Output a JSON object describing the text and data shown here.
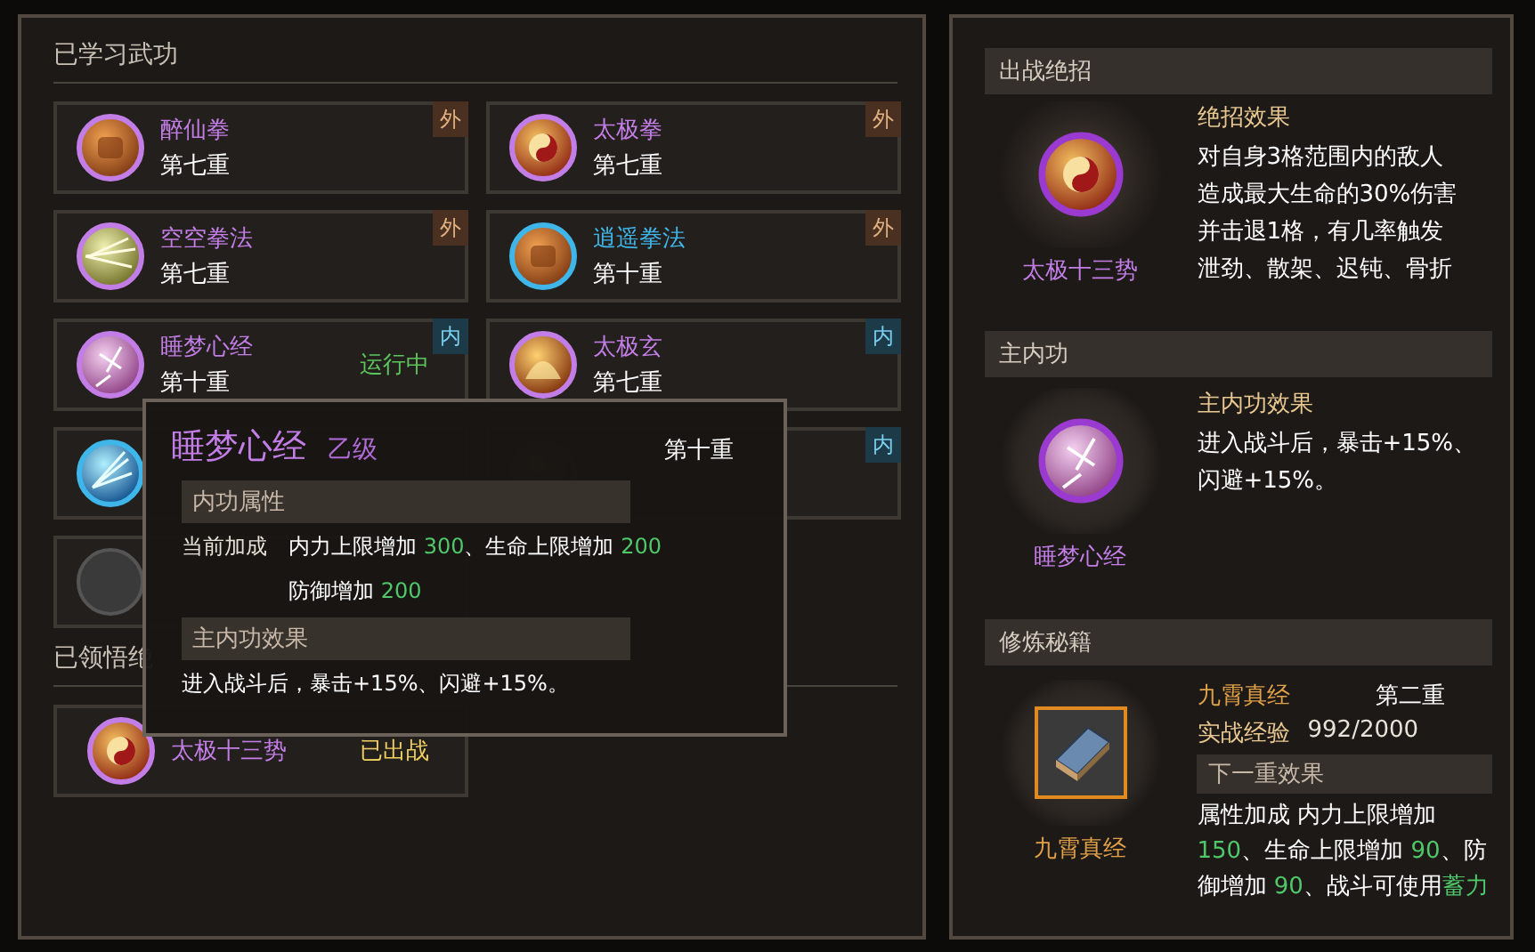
{
  "learned": {
    "title": "已学习武功",
    "skills": [
      {
        "kind": "skill",
        "name": "醉仙拳",
        "rank": "第七重",
        "color": "#c27ee6",
        "badge": {
          "text": "外",
          "kind": "outer"
        }
      },
      {
        "kind": "skill",
        "name": "太极拳",
        "rank": "第七重",
        "color": "#c27ee6",
        "badge": {
          "text": "外",
          "kind": "outer"
        }
      },
      {
        "kind": "skill",
        "name": "空空拳法",
        "rank": "第七重",
        "color": "#c27ee6",
        "badge": {
          "text": "外",
          "kind": "outer"
        }
      },
      {
        "kind": "skill",
        "name": "逍遥拳法",
        "rank": "第十重",
        "color": "#3fb6ea",
        "badge": {
          "text": "外",
          "kind": "outer"
        }
      },
      {
        "kind": "skill",
        "name": "睡梦心经",
        "rank": "第十重",
        "color": "#c27ee6",
        "badge": {
          "text": "内",
          "kind": "inner"
        },
        "status": {
          "text": "运行中",
          "kind": "running"
        }
      },
      {
        "kind": "skill",
        "name": "太极玄",
        "rank": "第七重",
        "color": "#c27ee6",
        "badge": {
          "text": "内",
          "kind": "inner"
        }
      },
      {
        "kind": "covered",
        "color": "#3fb6ea"
      },
      {
        "kind": "covered",
        "badge": {
          "text": "内",
          "kind": "inner"
        }
      },
      {
        "kind": "empty"
      }
    ]
  },
  "ultimates": {
    "title": "已领悟绝",
    "skills": [
      {
        "kind": "skill",
        "name": "太极十三势",
        "color": "#c27ee6",
        "status": {
          "text": "已出战",
          "kind": "deployed"
        }
      }
    ]
  },
  "tooltip": {
    "name": "睡梦心经",
    "grade": "乙级",
    "rank": "第十重",
    "attr_header": "内功属性",
    "bonus_label": "当前加成",
    "bonus_lines": [
      [
        {
          "text": "内力上限增加 ",
          "hl": false
        },
        {
          "text": "300",
          "hl": true
        },
        {
          "text": "、生命上限增加 ",
          "hl": false
        },
        {
          "text": "200",
          "hl": true
        }
      ],
      [
        {
          "text": "防御增加 ",
          "hl": false
        },
        {
          "text": "200",
          "hl": true
        }
      ]
    ],
    "effect_header": "主内功效果",
    "effect": "进入战斗后，暴击+15%、闪避+15%。"
  },
  "right": {
    "combat": {
      "header": "出战绝招",
      "name": "太极十三势",
      "effect_title": "绝招效果",
      "effect": "对自身3格范围内的敌人造成最大生命的30%伤害并击退1格，有几率触发泄劲、散架、迟钝、骨折"
    },
    "main_inner": {
      "header": "主内功",
      "name": "睡梦心经",
      "effect_title": "主内功效果",
      "effect": "进入战斗后，暴击+15%、闪避+15%。"
    },
    "manual": {
      "header": "修炼秘籍",
      "name": "九霄真经",
      "book_name": "九霄真经",
      "rank": "第二重",
      "exp_label": "实战经验",
      "exp": "992/2000",
      "next_header": "下一重效果",
      "bonus": [
        {
          "text": "属性加成  内力上限增加 ",
          "hl": false
        },
        {
          "text": "150",
          "hl": true
        },
        {
          "text": "、生命上限增加 ",
          "hl": false
        },
        {
          "text": "90",
          "hl": true
        },
        {
          "text": "、防御增加 ",
          "hl": false
        },
        {
          "text": "90",
          "hl": true
        },
        {
          "text": "、战斗可使用",
          "hl": false
        },
        {
          "text": "蓄力",
          "hl": true
        }
      ]
    }
  }
}
